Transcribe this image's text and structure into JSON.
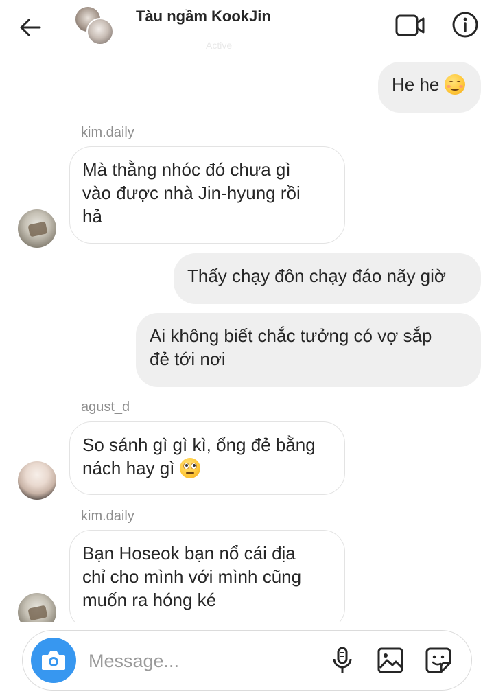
{
  "header": {
    "title": "Tàu ngầm KookJin",
    "subtitle": "Active"
  },
  "messages": [
    {
      "type": "outgoing",
      "text": "He he",
      "emoji": "smiling-face-icon"
    },
    {
      "type": "sender",
      "text": "kim.daily"
    },
    {
      "type": "incoming",
      "lines": [
        "Mà thằng nhóc đó chưa gì",
        "vào được nhà Jin-hyung rồi",
        "hả"
      ]
    },
    {
      "type": "outgoing",
      "text": "Thấy chạy đôn chạy đáo nãy giờ"
    },
    {
      "type": "outgoing",
      "lines": [
        "Ai không biết chắc tưởng có vợ sắp",
        "đẻ tới nơi"
      ]
    },
    {
      "type": "sender",
      "text": "agust_d"
    },
    {
      "type": "incoming",
      "lines": [
        "So sánh gì gì kì, ổng đẻ bằng",
        "nách hay gì"
      ],
      "emoji": "eye-roll-face-icon"
    },
    {
      "type": "sender",
      "text": "kim.daily"
    },
    {
      "type": "incoming",
      "lines": [
        "Bạn Hoseok bạn nổ cái địa",
        "chỉ cho mình với mình cũng",
        "muốn ra hóng ké"
      ]
    }
  ],
  "composer": {
    "placeholder": "Message..."
  },
  "colors": {
    "accent": "#3797f0",
    "bubble_out": "#efefef",
    "sender_gray": "#8e8e8e"
  }
}
